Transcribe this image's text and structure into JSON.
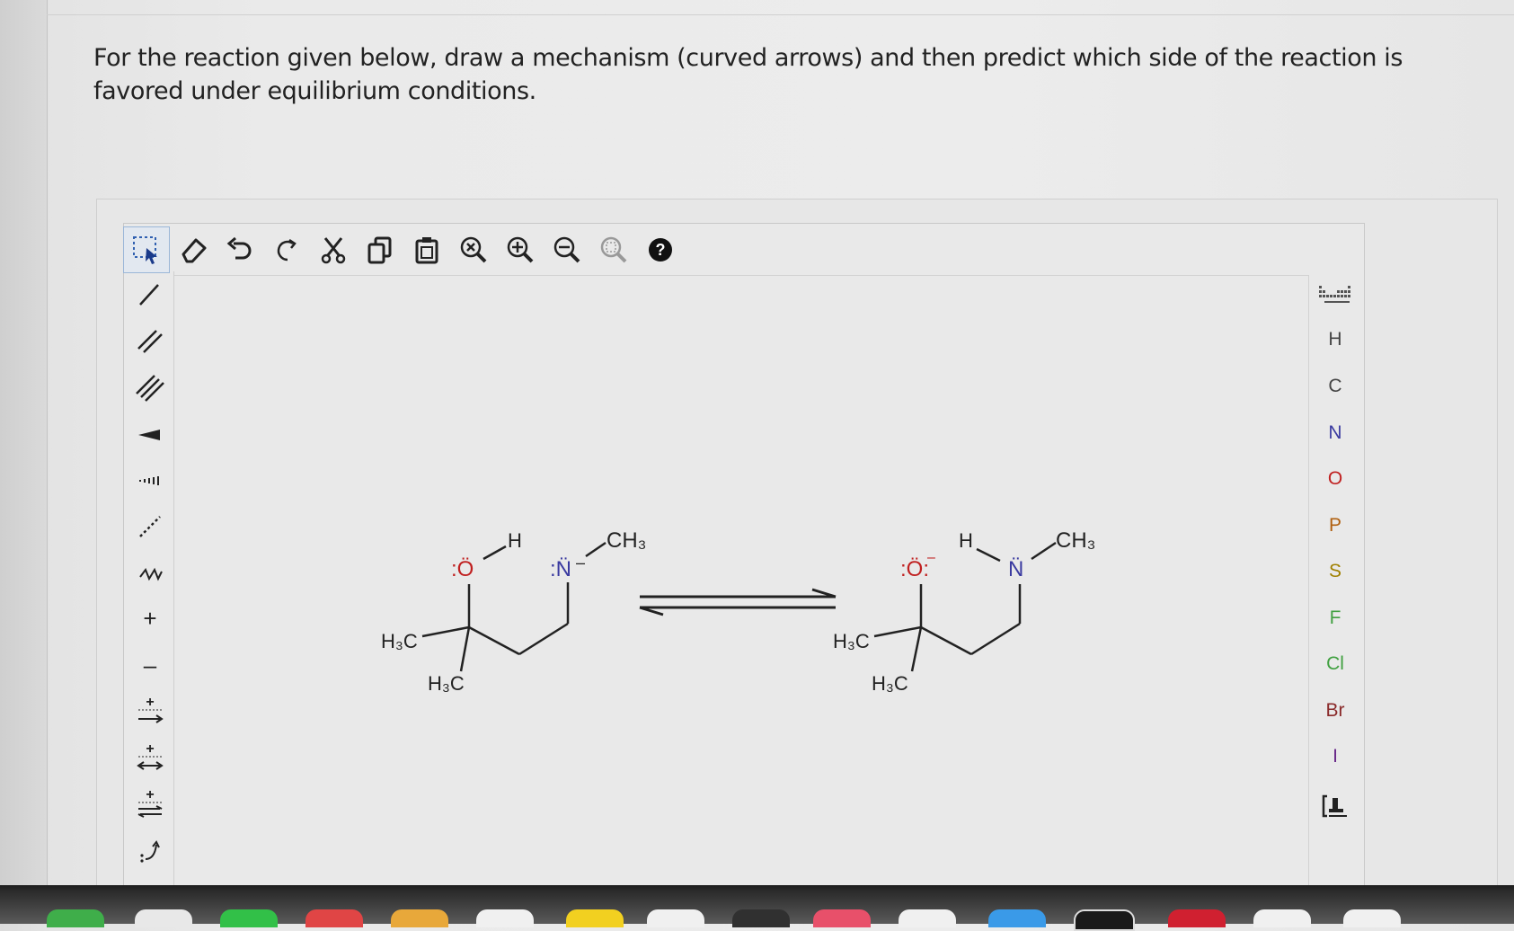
{
  "question": {
    "text": "For the reaction given below, draw a mechanism (curved arrows) and then predict which side of the reaction is favored under equilibrium conditions."
  },
  "toolbar": {
    "help_glyph": "?"
  },
  "left_tools": {
    "charge_plus": "+",
    "charge_minus": "–",
    "plus_label": "+"
  },
  "elements": [
    "H",
    "C",
    "N",
    "O",
    "P",
    "S",
    "F",
    "Cl",
    "Br",
    "I"
  ],
  "element_colors": {
    "H": "#444444",
    "C": "#444444",
    "N": "#3a3aa0",
    "O": "#c02020",
    "P": "#b06010",
    "S": "#a08000",
    "F": "#40a040",
    "Cl": "#40a040",
    "Br": "#8a2a2a",
    "I": "#6a2a8a"
  },
  "molecule_left": {
    "h3c_top": "H₃C",
    "h3c_bottom": "H₃C",
    "oxygen": ":Ö",
    "h": "H",
    "nitrogen": ":N̈",
    "n_charge": "–",
    "ch3": "CH₃"
  },
  "molecule_right": {
    "h3c_top": "H₃C",
    "h3c_bottom": "H₃C",
    "oxygen": ":Ö:",
    "o_charge": "–",
    "h": "H",
    "nitrogen": "N̈",
    "ch3": "CH₃"
  }
}
